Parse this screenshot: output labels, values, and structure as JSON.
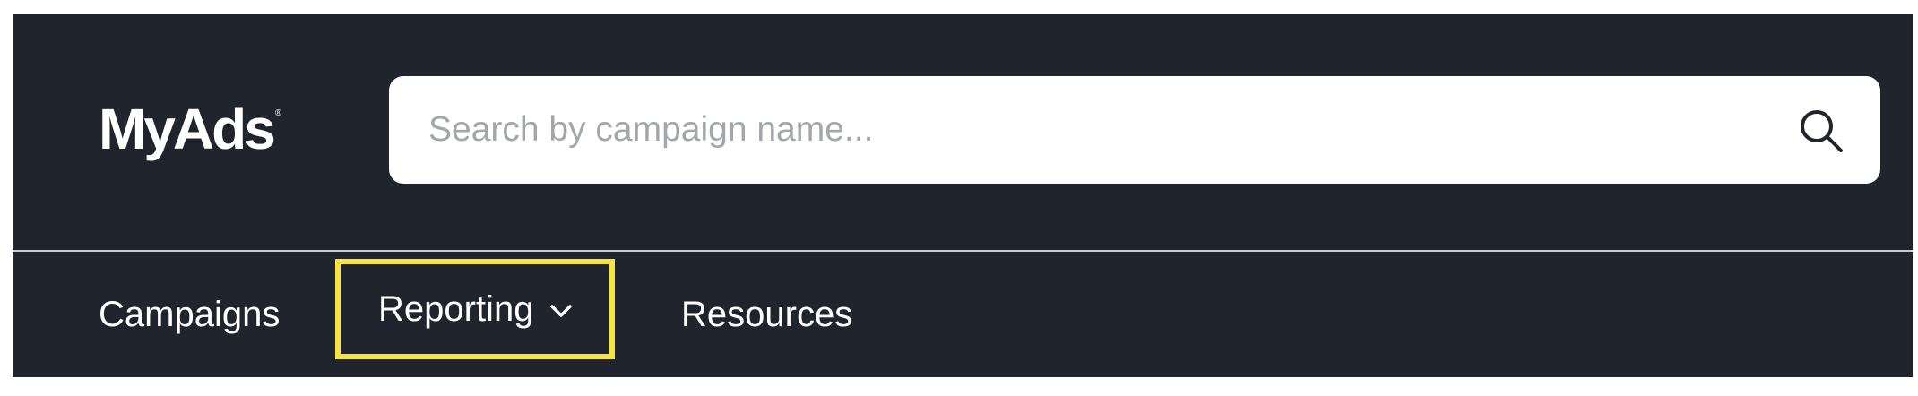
{
  "header": {
    "logo_text": "MyAds",
    "logo_mark": "®"
  },
  "search": {
    "placeholder": "Search by campaign name...",
    "value": "",
    "icon": "search-icon"
  },
  "nav": {
    "items": [
      {
        "label": "Campaigns"
      },
      {
        "label": "Reporting",
        "has_dropdown": true,
        "icon": "chevron-down-icon",
        "highlighted": true
      },
      {
        "label": "Resources"
      }
    ]
  },
  "colors": {
    "header_bg": "#20252d",
    "highlight_border": "#f7e442",
    "text": "#ffffff",
    "placeholder": "#a3a6aa"
  }
}
